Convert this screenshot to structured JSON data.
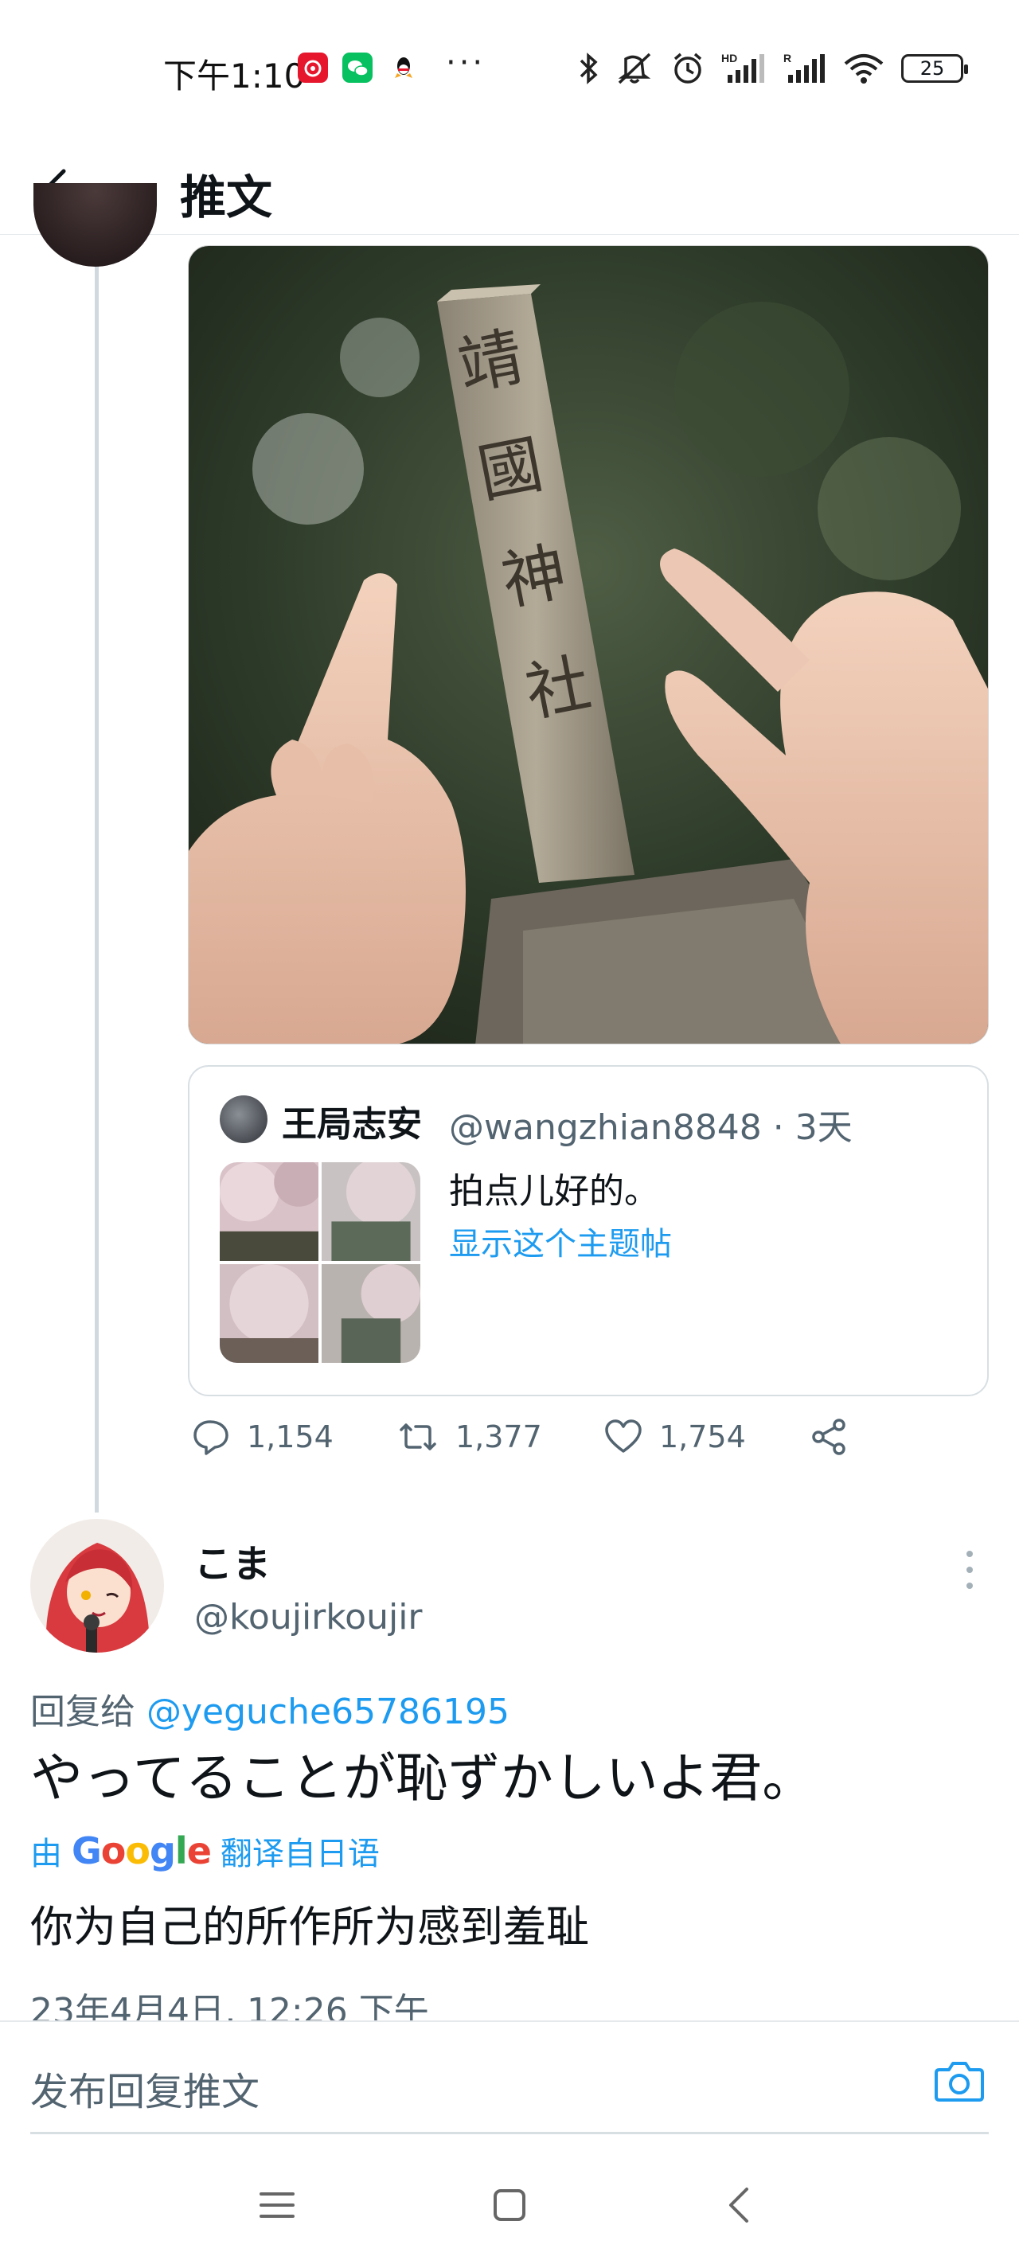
{
  "status_bar": {
    "time": "下午1:10",
    "more": "···",
    "battery": "25",
    "apps": [
      "weibo-icon",
      "wechat-icon",
      "qq-icon"
    ],
    "indicators": [
      "bluetooth-icon",
      "mute-icon",
      "alarm-icon",
      "hd-signal-icon",
      "roaming-signal-icon",
      "wifi-icon"
    ]
  },
  "header": {
    "title": "推文"
  },
  "quote": {
    "name": "王局志安",
    "handle": "@wangzhian8848 · 3天",
    "text": "拍点儿好的。",
    "show_thread": "显示这个主题帖"
  },
  "actions": {
    "replies": "1,154",
    "retweets": "1,377",
    "likes": "1,754"
  },
  "reply": {
    "name": "こま",
    "handle": "@koujirkoujir",
    "reply_prefix": "回复给 ",
    "reply_mention": "@yeguche65786195",
    "text": "やってることが恥ずかしいよ君。",
    "translate_by": "由",
    "translate_brand": "Google",
    "translate_label": "翻译自日语",
    "translation": "你为自己的所作所为感到羞耻",
    "timestamp": "23年4月4日, 12:26 下午"
  },
  "compose": {
    "placeholder": "发布回复推文"
  },
  "colors": {
    "accent": "#1d9bf0",
    "secondary_text": "#536471",
    "primary_text": "#0f1419"
  }
}
